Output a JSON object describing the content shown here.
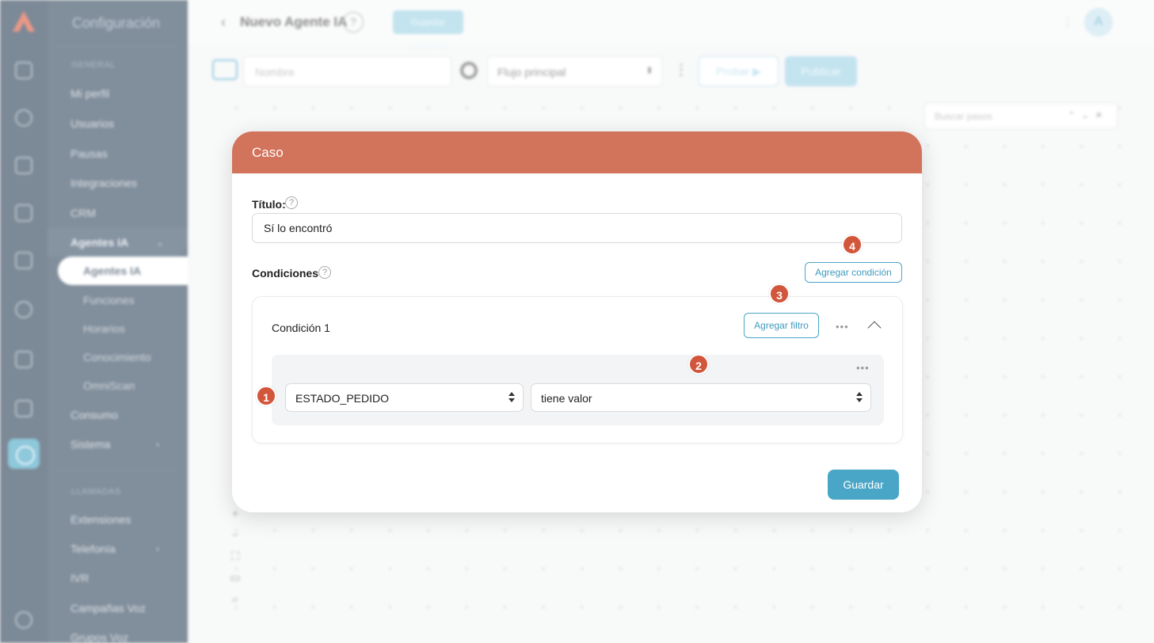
{
  "sidebar": {
    "header": "Configuración",
    "section_general": "GENERAL",
    "items": [
      {
        "label": "Mi perfil"
      },
      {
        "label": "Usuarios"
      },
      {
        "label": "Pausas"
      },
      {
        "label": "Integraciones"
      },
      {
        "label": "CRM"
      },
      {
        "label": "Agentes IA"
      },
      {
        "label": "Consumo"
      },
      {
        "label": "Sistema"
      }
    ],
    "sub_items": [
      {
        "label": "Agentes IA"
      },
      {
        "label": "Funciones"
      },
      {
        "label": "Horarios"
      },
      {
        "label": "Conocimiento"
      },
      {
        "label": "OmniScan"
      }
    ],
    "section_llamadas": "LLAMADAS",
    "call_items": [
      {
        "label": "Extensiones"
      },
      {
        "label": "Telefonía"
      },
      {
        "label": "IVR"
      },
      {
        "label": "Campañas Voz"
      },
      {
        "label": "Grupos Voz"
      }
    ]
  },
  "topbar": {
    "back": "‹",
    "title": "Nuevo Agente IA",
    "help": "?",
    "status_badge": "Guardar borrador",
    "avatar": "A"
  },
  "toolbar": {
    "name_placeholder": "Nombre",
    "flow_select": "Flujo principal",
    "test_label": "Probar ▶",
    "publish_label": "Publicar"
  },
  "canvas": {
    "step_search_placeholder": "Buscar pasos",
    "step_search_controls": "⌃⌄✕",
    "zoom_controls": [
      "+",
      "−",
      "⛶",
      "▭",
      "⌕"
    ]
  },
  "modal": {
    "title": "Caso",
    "title_label": "Título:",
    "title_value": "Sí lo encontró",
    "conditions_label": "Condiciones",
    "add_condition": "Agregar condición",
    "condition": {
      "title": "Condición 1",
      "add_filter": "Agregar filtro",
      "more": "•••",
      "filter_more": "•••",
      "field": "ESTADO_PEDIDO",
      "operator": "tiene valor"
    },
    "save": "Guardar",
    "help_icon": "?"
  },
  "badges": [
    "1",
    "2",
    "3",
    "4"
  ],
  "colors": {
    "header": "#d2735c",
    "accent": "#4aa6c6",
    "badge": "#d2563b",
    "sidebar": "#34495e"
  }
}
